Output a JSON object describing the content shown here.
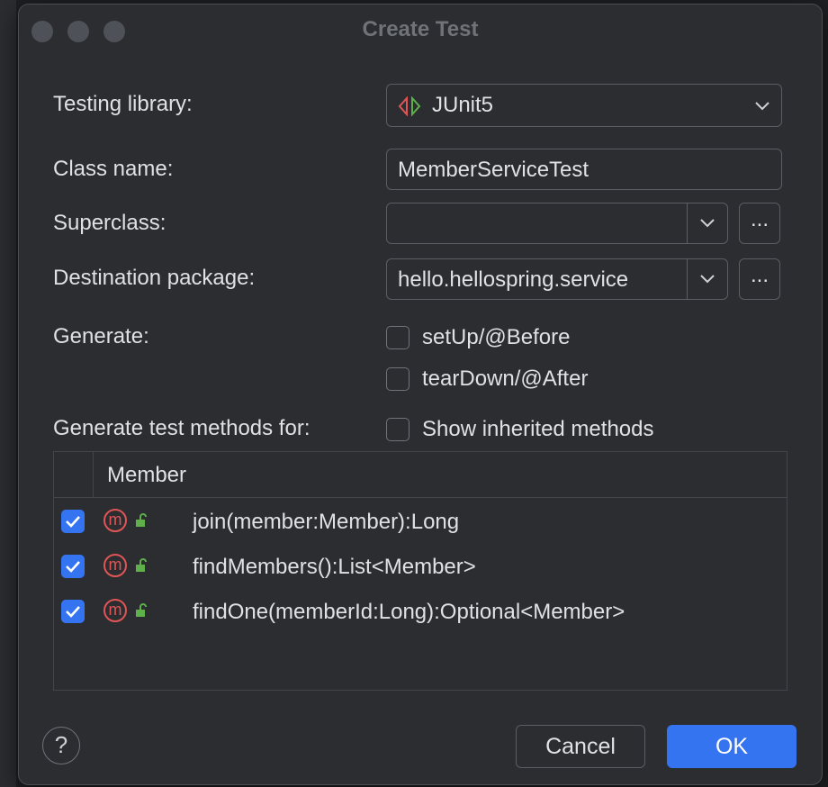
{
  "dialog": {
    "title": "Create Test",
    "testing_library": {
      "label": "Testing library:",
      "value": "JUnit5"
    },
    "class_name": {
      "label": "Class name:",
      "value": "MemberServiceTest"
    },
    "superclass": {
      "label": "Superclass:",
      "value": "",
      "browse": "..."
    },
    "destination_package": {
      "label": "Destination package:",
      "value": "hello.hellospring.service",
      "browse": "..."
    },
    "generate": {
      "label": "Generate:",
      "options": [
        {
          "label": "setUp/@Before",
          "checked": false
        },
        {
          "label": "tearDown/@After",
          "checked": false
        }
      ]
    },
    "methods_for": {
      "label": "Generate test methods for:",
      "show_inherited": {
        "label": "Show inherited methods",
        "checked": false
      }
    },
    "table": {
      "header": "Member",
      "rows": [
        {
          "icon": "m",
          "checked": true,
          "signature": "join(member:Member):Long"
        },
        {
          "icon": "m",
          "checked": true,
          "signature": "findMembers():List<Member>"
        },
        {
          "icon": "m",
          "checked": true,
          "signature": "findOne(memberId:Long):Optional<Member>"
        }
      ]
    },
    "buttons": {
      "help": "?",
      "cancel": "Cancel",
      "ok": "OK"
    }
  },
  "colors": {
    "accent": "#3574f0",
    "method_icon": "#e05555",
    "lock_icon": "#5fb04a"
  }
}
